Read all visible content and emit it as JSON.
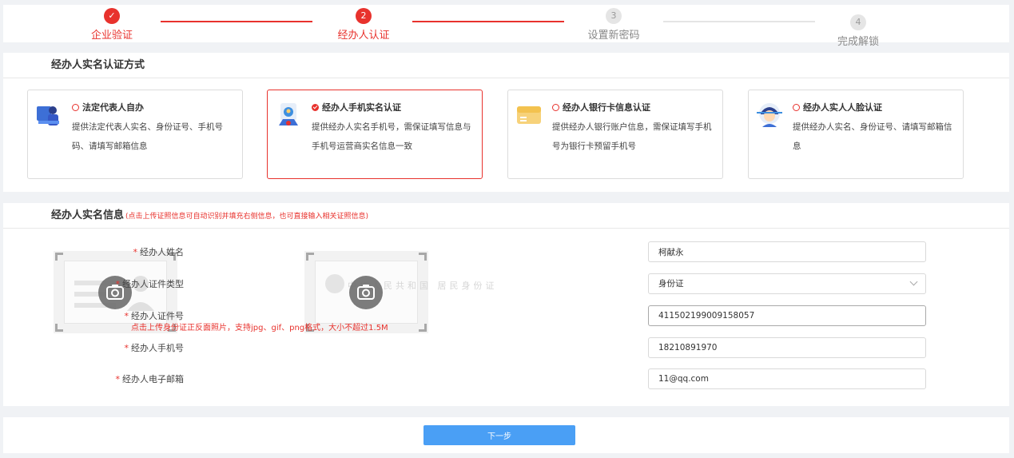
{
  "stepper": {
    "steps": [
      {
        "num": "✓",
        "label": "企业验证",
        "state": "done"
      },
      {
        "num": "2",
        "label": "经办人认证",
        "state": "active"
      },
      {
        "num": "3",
        "label": "设置新密码",
        "state": "todo"
      },
      {
        "num": "4",
        "label": "完成解锁",
        "state": "todo"
      }
    ]
  },
  "method_section": {
    "title": "经办人实名认证方式",
    "cards": [
      {
        "title": "法定代表人自办",
        "desc": "提供法定代表人实名、身份证号、手机号码、请填写邮箱信息",
        "selected": false,
        "icon": "legal-rep-icon"
      },
      {
        "title": "经办人手机实名认证",
        "desc": "提供经办人实名手机号，需保证填写信息与手机号运营商实名信息一致",
        "selected": true,
        "icon": "phone-id-icon"
      },
      {
        "title": "经办人银行卡信息认证",
        "desc": "提供经办人银行账户信息，需保证填写手机号为银行卡预留手机号",
        "selected": false,
        "icon": "bank-card-icon"
      },
      {
        "title": "经办人实人人脸认证",
        "desc": "提供经办人实名、身份证号、请填写邮箱信息",
        "selected": false,
        "icon": "face-scan-icon"
      }
    ]
  },
  "info_section": {
    "title": "经办人实名信息",
    "hint": "(点击上传证照信息可自动识别并填充右侧信息，也可直接输入相关证照信息)",
    "upload_tip": "点击上传身份证正反面照片，支持jpg、gif、png格式，大小不超过1.5M",
    "id_back_text": "中华人民共和国 居民身份证"
  },
  "form": {
    "required_mark": "*",
    "name_label": "经办人姓名",
    "name_value": "柯献永",
    "id_type_label": "经办人证件类型",
    "id_type_value": "身份证",
    "id_no_label": "经办人证件号",
    "id_no_value": "411502199009158057",
    "phone_label": "经办人手机号",
    "phone_value": "18210891970",
    "email_label": "经办人电子邮箱",
    "email_value": "11@qq.com"
  },
  "actions": {
    "next_label": "下一步"
  },
  "colors": {
    "accent_red": "#e8322d",
    "primary_blue": "#4a9ff5"
  }
}
